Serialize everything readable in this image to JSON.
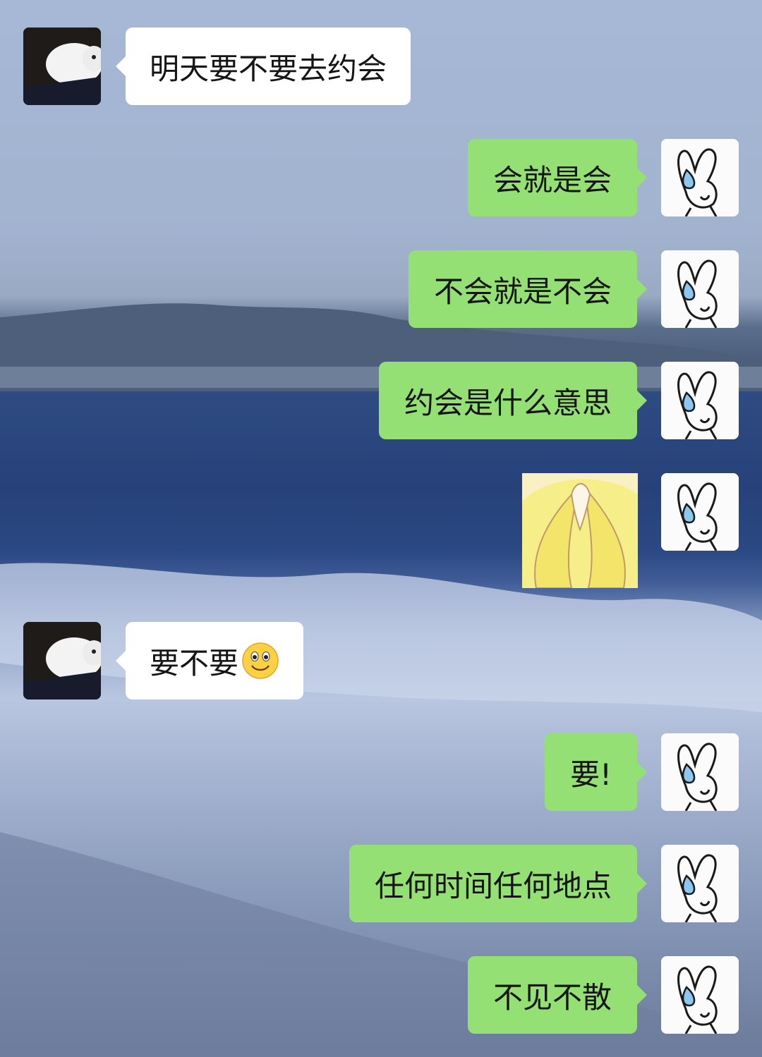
{
  "chat": {
    "messages": [
      {
        "sender": "cat",
        "text": "明天要不要去约会"
      },
      {
        "sender": "bunny",
        "text": "会就是会"
      },
      {
        "sender": "bunny",
        "text": "不会就是不会"
      },
      {
        "sender": "bunny",
        "text": "约会是什么意思"
      },
      {
        "sender": "bunny",
        "type": "sticker",
        "icon": "hands-heart-sticker"
      },
      {
        "sender": "cat",
        "text": "要不要",
        "emoji": "smiley-face-icon"
      },
      {
        "sender": "bunny",
        "text": "要!"
      },
      {
        "sender": "bunny",
        "text": "任何时间任何地点"
      },
      {
        "sender": "bunny",
        "text": "不见不散"
      }
    ]
  },
  "colors": {
    "outgoing_bubble": "#95e074",
    "incoming_bubble": "#ffffff"
  }
}
